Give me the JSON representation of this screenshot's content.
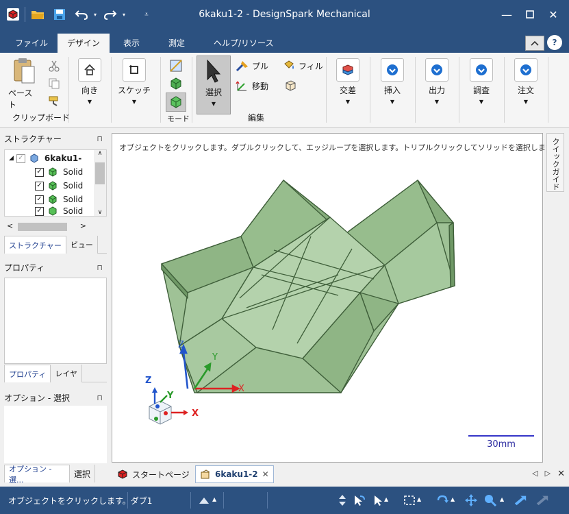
{
  "app": {
    "title": "6kaku1-2 - DesignSpark Mechanical",
    "brand_color": "#2c5180"
  },
  "window_controls": {
    "minimize": "—",
    "maximize": "☐",
    "close": "✕"
  },
  "ribbon_tabs": [
    "ファイル",
    "デザイン",
    "表示",
    "測定",
    "ヘルプ/リソース"
  ],
  "active_tab": "デザイン",
  "ribbon": {
    "paste": "ペースト",
    "clipboard_group": "クリップボード",
    "orient": "向き",
    "sketch": "スケッチ",
    "mode_group": "モード",
    "select": "選択",
    "pull": "プル",
    "move": "移動",
    "fill": "フィル",
    "edit_group": "編集",
    "intersect": "交差",
    "insert": "挿入",
    "output": "出力",
    "inspect": "調査",
    "order": "注文"
  },
  "structure": {
    "title": "ストラクチャー",
    "root": "6kaku1-",
    "items": [
      "Solid",
      "Solid",
      "Solid",
      "Solid"
    ],
    "tab_structure": "ストラクチャー",
    "tab_view": "ビュー"
  },
  "properties": {
    "title": "プロパティ",
    "tab_properties": "プロパティ",
    "tab_layers": "レイヤ"
  },
  "options": {
    "title": "オプション - 選択",
    "tab_options": "オプション - 選...",
    "tab_select": "選択"
  },
  "viewport": {
    "hint": "オブジェクトをクリックします。ダブルクリックして、エッジループを選択します。トリプルクリックしてソリッドを選択します。",
    "scale": "30mm",
    "axis_x": "X",
    "axis_y": "Y",
    "axis_z": "Z",
    "model_color": "#9dbf92"
  },
  "quick_guide": "クイックガイド",
  "doc_tabs": {
    "start": "スタートページ",
    "current": "6kaku1-2"
  },
  "status": {
    "text": "オブジェクトをクリックします。ダブ1"
  }
}
